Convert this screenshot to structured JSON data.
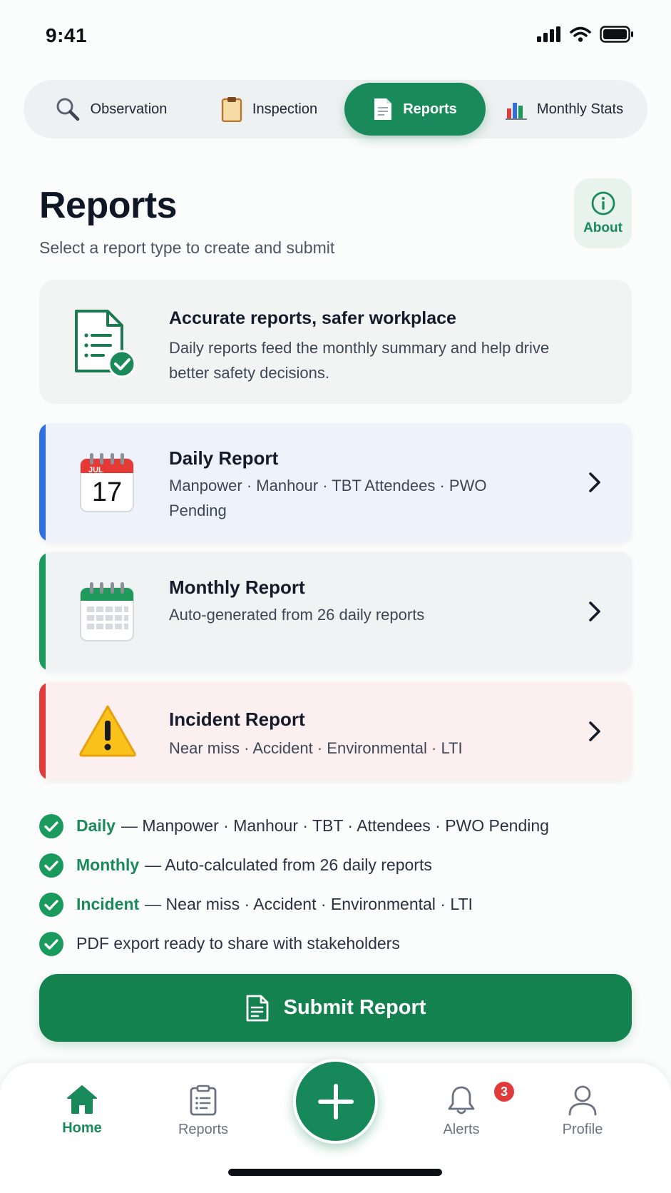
{
  "status_bar": {
    "time": "9:41"
  },
  "top_tabs": [
    {
      "label": "Observation",
      "icon": "magnifier-icon",
      "active": false
    },
    {
      "label": "Inspection",
      "icon": "clipboard-icon",
      "active": false
    },
    {
      "label": "Reports",
      "icon": "document-icon",
      "active": true
    },
    {
      "label": "Monthly Stats",
      "icon": "bar-chart-icon",
      "active": false
    }
  ],
  "header": {
    "title": "Reports",
    "subtitle": "Select a report type to create and submit",
    "about_label": "About"
  },
  "info_banner": {
    "title": "Accurate reports, safer workplace",
    "text": "Daily reports feed the monthly summary and help drive better safety decisions."
  },
  "report_types": [
    {
      "title": "Daily Report",
      "description": "Manpower · Manhour · TBT Attendees · PWO Pending",
      "icon_month": "JUL",
      "icon_day": "17",
      "accent": "#2f6fe0"
    },
    {
      "title": "Monthly Report",
      "description": "Auto-generated from 26 daily reports",
      "accent": "#1b9a5e"
    },
    {
      "title": "Incident Report",
      "description": "Near miss · Accident · Environmental · LTI",
      "accent": "#e13a3a"
    }
  ],
  "checklist": [
    {
      "keyword": "Daily",
      "text": "— Manpower · Manhour · TBT · Attendees · PWO Pending"
    },
    {
      "keyword": "Monthly",
      "text": "— Auto-calculated from 26 daily reports"
    },
    {
      "keyword": "Incident",
      "text": "— Near miss · Accident · Environmental · LTI"
    },
    {
      "keyword": "",
      "text": "PDF export ready to share with stakeholders"
    }
  ],
  "submit_label": "Submit Report",
  "bottom_nav": {
    "home": "Home",
    "reports": "Reports",
    "alerts": "Alerts",
    "alerts_badge": "3",
    "profile": "Profile"
  },
  "colors": {
    "brand_green": "#1b8a5a",
    "daily_accent": "#2f6fe0",
    "monthly_accent": "#1b9a5e",
    "incident_accent": "#e13a3a",
    "badge_red": "#e23b3b"
  }
}
